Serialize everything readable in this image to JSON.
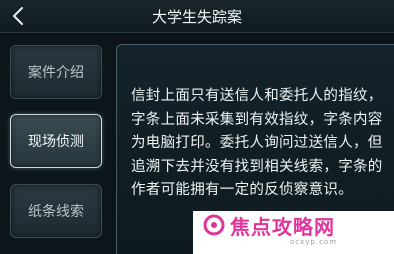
{
  "header": {
    "title": "大学生失踪案",
    "back_icon": "chevron-left-icon"
  },
  "sidebar": {
    "items": [
      {
        "label": "案件介绍",
        "active": false
      },
      {
        "label": "现场侦测",
        "active": true
      },
      {
        "label": "纸条线索",
        "active": false
      }
    ]
  },
  "content": {
    "text": "信封上面只有送信人和委托人的指纹，字条上面未采集到有效指纹，字条内容为电脑打印。委托人询问过送信人，但追溯下去并没有找到相关线索，字条的作者可能拥有一定的反侦察意识。"
  },
  "watermark": {
    "brand": "焦点攻略网",
    "url": "ocxyp.com",
    "brand_color": "#e0359a"
  }
}
